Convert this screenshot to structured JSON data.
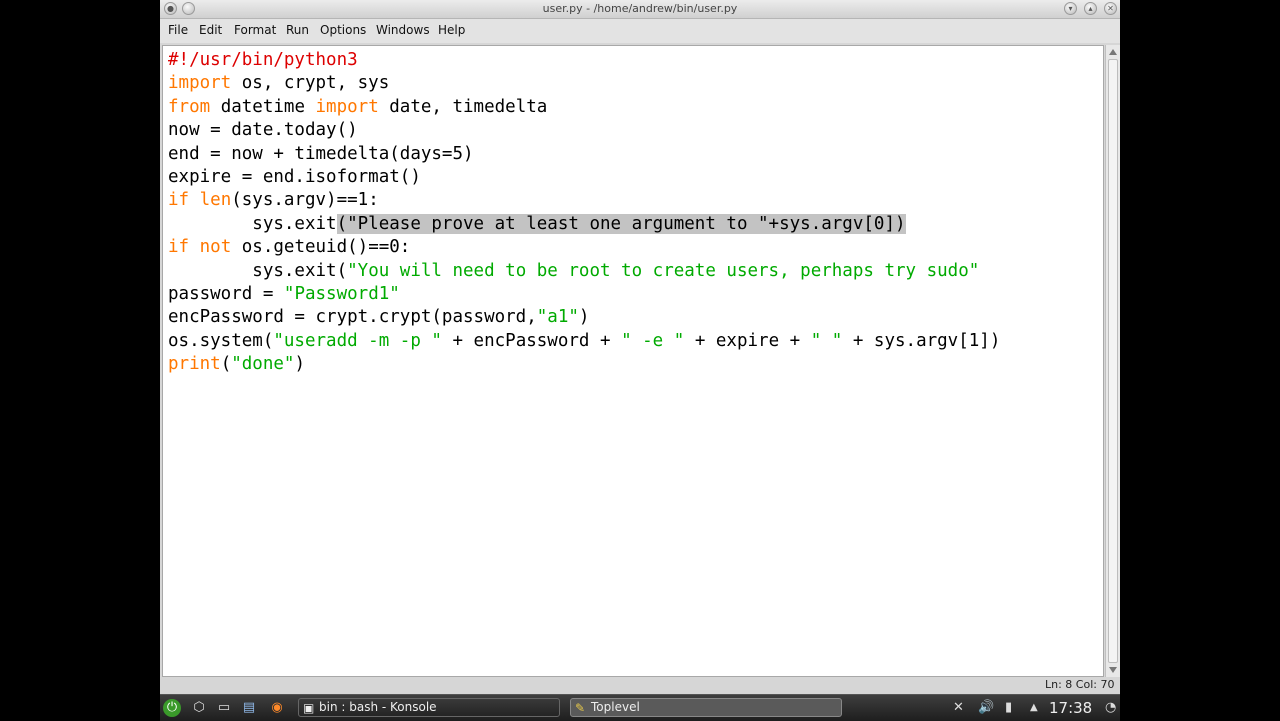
{
  "window": {
    "title": "user.py - /home/andrew/bin/user.py"
  },
  "menu": {
    "items": [
      {
        "label": "File"
      },
      {
        "label": "Edit"
      },
      {
        "label": "Format"
      },
      {
        "label": "Run"
      },
      {
        "label": "Options"
      },
      {
        "label": "Windows"
      },
      {
        "label": "Help"
      }
    ]
  },
  "editor": {
    "lines": [
      [
        {
          "t": "#!/usr/bin/python3",
          "c": "cmt"
        }
      ],
      [
        {
          "t": "import",
          "c": "kw"
        },
        {
          "t": " os, crypt, sys",
          "c": ""
        }
      ],
      [
        {
          "t": "from",
          "c": "kw"
        },
        {
          "t": " datetime ",
          "c": ""
        },
        {
          "t": "import",
          "c": "kw"
        },
        {
          "t": " date, timedelta",
          "c": ""
        }
      ],
      [
        {
          "t": "now = date.today()",
          "c": ""
        }
      ],
      [
        {
          "t": "end = now + timedelta(days=5)",
          "c": ""
        }
      ],
      [
        {
          "t": "expire = end.isoformat()",
          "c": ""
        }
      ],
      [
        {
          "t": "if",
          "c": "kw"
        },
        {
          "t": " ",
          "c": ""
        },
        {
          "t": "len",
          "c": "kw"
        },
        {
          "t": "(sys.argv)==1:",
          "c": ""
        }
      ],
      [
        {
          "t": "        sys.exit",
          "c": ""
        },
        {
          "t": "(\"Please prove at least one argument to \"+sys.argv[0])",
          "c": "sel"
        }
      ],
      [
        {
          "t": "if",
          "c": "kw"
        },
        {
          "t": " ",
          "c": ""
        },
        {
          "t": "not",
          "c": "kw"
        },
        {
          "t": " os.geteuid()==0:",
          "c": ""
        }
      ],
      [
        {
          "t": "        sys.exit(",
          "c": ""
        },
        {
          "t": "\"You will need to be root to create users, perhaps try sudo\"",
          "c": "str"
        }
      ],
      [
        {
          "t": "password = ",
          "c": ""
        },
        {
          "t": "\"Password1\"",
          "c": "str"
        }
      ],
      [
        {
          "t": "encPassword = crypt.crypt(password,",
          "c": ""
        },
        {
          "t": "\"a1\"",
          "c": "str"
        },
        {
          "t": ")",
          "c": ""
        }
      ],
      [
        {
          "t": "os.system(",
          "c": ""
        },
        {
          "t": "\"useradd -m -p \"",
          "c": "str"
        },
        {
          "t": " + encPassword + ",
          "c": ""
        },
        {
          "t": "\" -e \"",
          "c": "str"
        },
        {
          "t": " + expire + ",
          "c": ""
        },
        {
          "t": "\" \"",
          "c": "str"
        },
        {
          "t": " + sys.argv[1])",
          "c": ""
        }
      ],
      [
        {
          "t": "print",
          "c": "kw"
        },
        {
          "t": "(",
          "c": ""
        },
        {
          "t": "\"done\"",
          "c": "str"
        },
        {
          "t": ")",
          "c": ""
        }
      ]
    ]
  },
  "status": {
    "position": "Ln: 8 Col: 70"
  },
  "taskbar": {
    "tasks": [
      {
        "label": "bin : bash - Konsole",
        "icon": "terminal-icon"
      },
      {
        "label": "Toplevel",
        "icon": "idle-icon"
      }
    ],
    "clock": "17:38"
  }
}
